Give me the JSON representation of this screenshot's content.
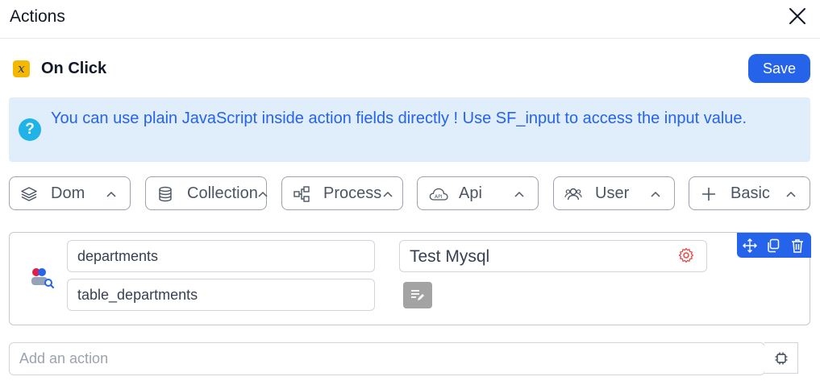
{
  "header": {
    "title": "Actions",
    "close_icon": "close-icon"
  },
  "trigger": {
    "icon_glyph": "x",
    "label": "On Click",
    "icon_color": "#f5b800"
  },
  "toolbar": {
    "save_label": "Save"
  },
  "info": {
    "text": "You can use plain JavaScript inside action fields directly ! Use SF_input to access the input value.",
    "icon": "help-icon",
    "color": "#2563eb",
    "background": "#e0eefb"
  },
  "categories": [
    {
      "label": "Dom",
      "icon": "layers-icon"
    },
    {
      "label": "Collection",
      "icon": "database-icon"
    },
    {
      "label": "Process",
      "icon": "flow-icon"
    },
    {
      "label": "Api",
      "icon": "cloud-api-icon"
    },
    {
      "label": "User",
      "icon": "users-icon"
    },
    {
      "label": "Basic",
      "icon": "plus-icon"
    }
  ],
  "action": {
    "icon": "database-query-icon",
    "collection_value": "departments",
    "table_value": "table_departments",
    "connection_label": "Test Mysql",
    "connection_icon": "settings-icon",
    "edit_icon": "edit-notes-icon",
    "toolbar_icons": [
      "move-icon",
      "copy-icon",
      "trash-icon"
    ]
  },
  "add_action": {
    "placeholder": "Add an action",
    "button_icon": "chip-icon"
  },
  "colors": {
    "accent": "#2563eb",
    "danger": "#ef4444"
  }
}
